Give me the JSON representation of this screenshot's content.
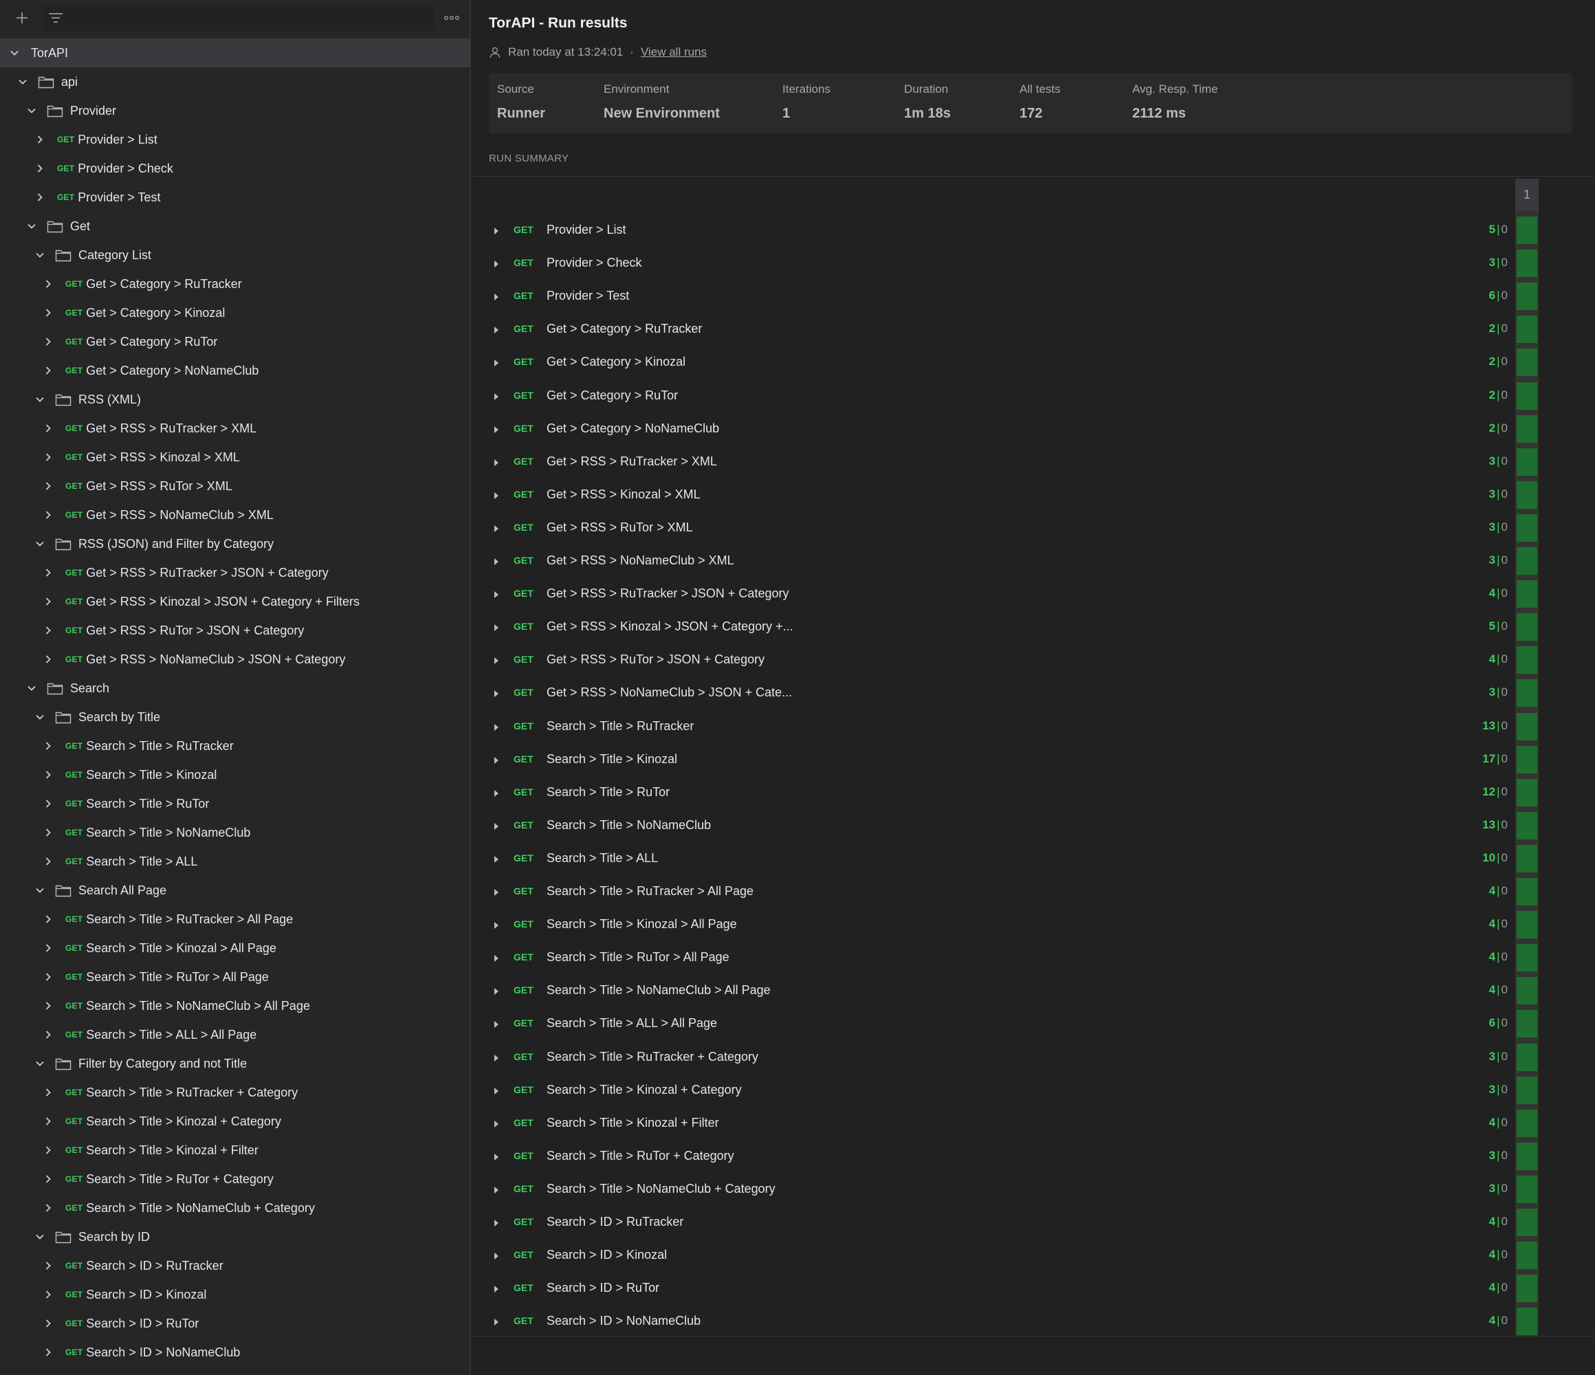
{
  "sidebar": {
    "icons": {
      "add": "plus-icon",
      "filter": "filter-icon",
      "more": "more-icon"
    },
    "tree": [
      {
        "level": 0,
        "type": "folder",
        "label": "TorAPI",
        "root": true
      },
      {
        "level": 1,
        "type": "folder",
        "label": "api"
      },
      {
        "level": 2,
        "type": "folder",
        "label": "Provider"
      },
      {
        "level": 3,
        "type": "request",
        "method": "GET",
        "label": "Provider > List"
      },
      {
        "level": 3,
        "type": "request",
        "method": "GET",
        "label": "Provider > Check"
      },
      {
        "level": 3,
        "type": "request",
        "method": "GET",
        "label": "Provider > Test"
      },
      {
        "level": 2,
        "type": "folder",
        "label": "Get"
      },
      {
        "level": 3,
        "type": "folder",
        "label": "Category List"
      },
      {
        "level": 4,
        "type": "request",
        "method": "GET",
        "label": "Get > Category > RuTracker"
      },
      {
        "level": 4,
        "type": "request",
        "method": "GET",
        "label": "Get > Category > Kinozal"
      },
      {
        "level": 4,
        "type": "request",
        "method": "GET",
        "label": "Get > Category > RuTor"
      },
      {
        "level": 4,
        "type": "request",
        "method": "GET",
        "label": "Get > Category > NoNameClub"
      },
      {
        "level": 3,
        "type": "folder",
        "label": "RSS (XML)"
      },
      {
        "level": 4,
        "type": "request",
        "method": "GET",
        "label": "Get > RSS > RuTracker > XML"
      },
      {
        "level": 4,
        "type": "request",
        "method": "GET",
        "label": "Get > RSS > Kinozal > XML"
      },
      {
        "level": 4,
        "type": "request",
        "method": "GET",
        "label": "Get > RSS > RuTor > XML"
      },
      {
        "level": 4,
        "type": "request",
        "method": "GET",
        "label": "Get > RSS > NoNameClub > XML"
      },
      {
        "level": 3,
        "type": "folder",
        "label": "RSS (JSON) and Filter by Category"
      },
      {
        "level": 4,
        "type": "request",
        "method": "GET",
        "label": "Get > RSS > RuTracker > JSON + Category"
      },
      {
        "level": 4,
        "type": "request",
        "method": "GET",
        "label": "Get > RSS > Kinozal > JSON + Category + Filters"
      },
      {
        "level": 4,
        "type": "request",
        "method": "GET",
        "label": "Get > RSS > RuTor > JSON + Category"
      },
      {
        "level": 4,
        "type": "request",
        "method": "GET",
        "label": "Get > RSS > NoNameClub > JSON + Category"
      },
      {
        "level": 2,
        "type": "folder",
        "label": "Search"
      },
      {
        "level": 3,
        "type": "folder",
        "label": "Search by Title"
      },
      {
        "level": 4,
        "type": "request",
        "method": "GET",
        "label": "Search > Title > RuTracker"
      },
      {
        "level": 4,
        "type": "request",
        "method": "GET",
        "label": "Search > Title > Kinozal"
      },
      {
        "level": 4,
        "type": "request",
        "method": "GET",
        "label": "Search > Title > RuTor"
      },
      {
        "level": 4,
        "type": "request",
        "method": "GET",
        "label": "Search > Title > NoNameClub"
      },
      {
        "level": 4,
        "type": "request",
        "method": "GET",
        "label": "Search > Title > ALL"
      },
      {
        "level": 3,
        "type": "folder",
        "label": "Search All Page"
      },
      {
        "level": 4,
        "type": "request",
        "method": "GET",
        "label": "Search > Title > RuTracker > All Page"
      },
      {
        "level": 4,
        "type": "request",
        "method": "GET",
        "label": "Search > Title > Kinozal > All Page"
      },
      {
        "level": 4,
        "type": "request",
        "method": "GET",
        "label": "Search > Title > RuTor > All Page"
      },
      {
        "level": 4,
        "type": "request",
        "method": "GET",
        "label": "Search > Title > NoNameClub > All Page"
      },
      {
        "level": 4,
        "type": "request",
        "method": "GET",
        "label": "Search > Title > ALL > All Page"
      },
      {
        "level": 3,
        "type": "folder",
        "label": "Filter by Category and not Title"
      },
      {
        "level": 4,
        "type": "request",
        "method": "GET",
        "label": "Search > Title > RuTracker + Category"
      },
      {
        "level": 4,
        "type": "request",
        "method": "GET",
        "label": "Search > Title > Kinozal + Category"
      },
      {
        "level": 4,
        "type": "request",
        "method": "GET",
        "label": "Search > Title > Kinozal + Filter"
      },
      {
        "level": 4,
        "type": "request",
        "method": "GET",
        "label": "Search > Title > RuTor + Category"
      },
      {
        "level": 4,
        "type": "request",
        "method": "GET",
        "label": "Search > Title > NoNameClub + Category"
      },
      {
        "level": 3,
        "type": "folder",
        "label": "Search by ID"
      },
      {
        "level": 4,
        "type": "request",
        "method": "GET",
        "label": "Search > ID > RuTracker"
      },
      {
        "level": 4,
        "type": "request",
        "method": "GET",
        "label": "Search > ID > Kinozal"
      },
      {
        "level": 4,
        "type": "request",
        "method": "GET",
        "label": "Search > ID > RuTor"
      },
      {
        "level": 4,
        "type": "request",
        "method": "GET",
        "label": "Search > ID > NoNameClub"
      }
    ]
  },
  "main": {
    "title": "TorAPI - Run results",
    "ran_text": "Ran today at 13:24:01",
    "separator": "·",
    "view_all_runs": "View all runs",
    "stats": [
      {
        "label": "Source",
        "value": "Runner"
      },
      {
        "label": "Environment",
        "value": "New Environment"
      },
      {
        "label": "Iterations",
        "value": "1"
      },
      {
        "label": "Duration",
        "value": "1m 18s"
      },
      {
        "label": "All tests",
        "value": "172"
      },
      {
        "label": "Avg. Resp. Time",
        "value": "2112 ms"
      }
    ],
    "summary_label": "RUN SUMMARY",
    "iteration_header": "1",
    "runs": [
      {
        "method": "GET",
        "name": "Provider > List",
        "passed": "5",
        "failed": "0"
      },
      {
        "method": "GET",
        "name": "Provider > Check",
        "passed": "3",
        "failed": "0"
      },
      {
        "method": "GET",
        "name": "Provider > Test",
        "passed": "6",
        "failed": "0"
      },
      {
        "method": "GET",
        "name": "Get > Category > RuTracker",
        "passed": "2",
        "failed": "0"
      },
      {
        "method": "GET",
        "name": "Get > Category > Kinozal",
        "passed": "2",
        "failed": "0"
      },
      {
        "method": "GET",
        "name": "Get > Category > RuTor",
        "passed": "2",
        "failed": "0"
      },
      {
        "method": "GET",
        "name": "Get > Category > NoNameClub",
        "passed": "2",
        "failed": "0"
      },
      {
        "method": "GET",
        "name": "Get > RSS > RuTracker > XML",
        "passed": "3",
        "failed": "0"
      },
      {
        "method": "GET",
        "name": "Get > RSS > Kinozal > XML",
        "passed": "3",
        "failed": "0"
      },
      {
        "method": "GET",
        "name": "Get > RSS > RuTor > XML",
        "passed": "3",
        "failed": "0"
      },
      {
        "method": "GET",
        "name": "Get > RSS > NoNameClub > XML",
        "passed": "3",
        "failed": "0"
      },
      {
        "method": "GET",
        "name": "Get > RSS > RuTracker > JSON + Category",
        "passed": "4",
        "failed": "0"
      },
      {
        "method": "GET",
        "name": "Get > RSS > Kinozal > JSON + Category +...",
        "passed": "5",
        "failed": "0"
      },
      {
        "method": "GET",
        "name": "Get > RSS > RuTor > JSON + Category",
        "passed": "4",
        "failed": "0"
      },
      {
        "method": "GET",
        "name": "Get > RSS > NoNameClub > JSON + Cate...",
        "passed": "3",
        "failed": "0"
      },
      {
        "method": "GET",
        "name": "Search > Title > RuTracker",
        "passed": "13",
        "failed": "0"
      },
      {
        "method": "GET",
        "name": "Search > Title > Kinozal",
        "passed": "17",
        "failed": "0"
      },
      {
        "method": "GET",
        "name": "Search > Title > RuTor",
        "passed": "12",
        "failed": "0"
      },
      {
        "method": "GET",
        "name": "Search > Title > NoNameClub",
        "passed": "13",
        "failed": "0"
      },
      {
        "method": "GET",
        "name": "Search > Title > ALL",
        "passed": "10",
        "failed": "0"
      },
      {
        "method": "GET",
        "name": "Search > Title > RuTracker > All Page",
        "passed": "4",
        "failed": "0"
      },
      {
        "method": "GET",
        "name": "Search > Title > Kinozal > All Page",
        "passed": "4",
        "failed": "0"
      },
      {
        "method": "GET",
        "name": "Search > Title > RuTor > All Page",
        "passed": "4",
        "failed": "0"
      },
      {
        "method": "GET",
        "name": "Search > Title > NoNameClub > All Page",
        "passed": "4",
        "failed": "0"
      },
      {
        "method": "GET",
        "name": "Search > Title > ALL > All Page",
        "passed": "6",
        "failed": "0"
      },
      {
        "method": "GET",
        "name": "Search > Title > RuTracker + Category",
        "passed": "3",
        "failed": "0"
      },
      {
        "method": "GET",
        "name": "Search > Title > Kinozal + Category",
        "passed": "3",
        "failed": "0"
      },
      {
        "method": "GET",
        "name": "Search > Title > Kinozal + Filter",
        "passed": "4",
        "failed": "0"
      },
      {
        "method": "GET",
        "name": "Search > Title > RuTor + Category",
        "passed": "3",
        "failed": "0"
      },
      {
        "method": "GET",
        "name": "Search > Title > NoNameClub + Category",
        "passed": "3",
        "failed": "0"
      },
      {
        "method": "GET",
        "name": "Search > ID > RuTracker",
        "passed": "4",
        "failed": "0"
      },
      {
        "method": "GET",
        "name": "Search > ID > Kinozal",
        "passed": "4",
        "failed": "0"
      },
      {
        "method": "GET",
        "name": "Search > ID > RuTor",
        "passed": "4",
        "failed": "0"
      },
      {
        "method": "GET",
        "name": "Search > ID > NoNameClub",
        "passed": "4",
        "failed": "0"
      }
    ]
  },
  "colors": {
    "background": "#212121",
    "sidebar": "#262626",
    "selected_row": "#3a3a3e",
    "method_get": "#3ecf5e",
    "pass_bar": "#1e6e2f",
    "muted_text": "#a8a8a8"
  }
}
